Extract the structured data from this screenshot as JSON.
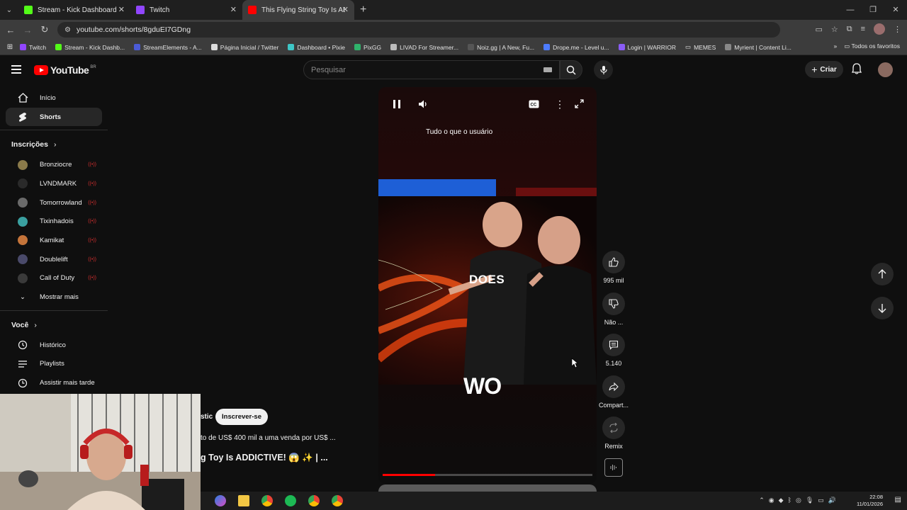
{
  "browser": {
    "tabs": [
      {
        "title": "Stream - Kick Dashboard",
        "color": "#53fc18"
      },
      {
        "title": "Twitch",
        "color": "#9146ff"
      },
      {
        "title": "This Flying String Toy Is ADDI",
        "color": "#ff0000"
      }
    ],
    "url": "youtube.com/shorts/8gduEI7GDng",
    "bookmarks": [
      {
        "label": "Twitch",
        "color": "#9146ff"
      },
      {
        "label": "Stream - Kick Dashb...",
        "color": "#53fc18"
      },
      {
        "label": "StreamElements - A...",
        "color": "#4b5bd6"
      },
      {
        "label": "Página Inicial / Twitter",
        "color": "#dddddd"
      },
      {
        "label": "Dashboard • Pixie",
        "color": "#3ec7c7"
      },
      {
        "label": "PixGG",
        "color": "#2fb36b"
      },
      {
        "label": "LIVAD For Streamer...",
        "color": "#bbbbbb"
      },
      {
        "label": "Noiz.gg | A New, Fu...",
        "color": "#222222"
      },
      {
        "label": "Drope.me - Level u...",
        "color": "#4d7cff"
      },
      {
        "label": "Login | WARRIOR",
        "color": "#8a5cf6"
      },
      {
        "label": "MEMES",
        "color": "#cccccc"
      },
      {
        "label": "Myrient | Content Li...",
        "color": "#888888"
      }
    ],
    "all_bookmarks_label": "Todos os favoritos"
  },
  "youtube": {
    "logo_text": "YouTube",
    "country_code": "BR",
    "search_placeholder": "Pesquisar",
    "create_label": "Criar"
  },
  "sidebar": {
    "home_label": "Início",
    "shorts_label": "Shorts",
    "subscriptions_title": "Inscrições",
    "subscriptions": [
      {
        "name": "Bronziocre",
        "color": "#8a7a4a"
      },
      {
        "name": "LVNDMARK",
        "color": "#2a2a2a"
      },
      {
        "name": "Tomorrowland",
        "color": "#6a6a6a"
      },
      {
        "name": "Tixinhadois",
        "color": "#3aa0a0"
      },
      {
        "name": "Kamikat",
        "color": "#c4743a"
      },
      {
        "name": "Doublelift",
        "color": "#4a4a6a"
      },
      {
        "name": "Call of Duty",
        "color": "#3a3a3a"
      }
    ],
    "show_more_label": "Mostrar mais",
    "you_title": "Você",
    "you_items": [
      {
        "label": "Histórico"
      },
      {
        "label": "Playlists"
      },
      {
        "label": "Assistir mais tarde"
      }
    ]
  },
  "short": {
    "overlay_title": "Tudo o que o usuário",
    "caption": "DOES",
    "watermark": "WO",
    "progress": 0.25,
    "channel_name_fragment": "stic",
    "subscribe_label": "Inscrever-se",
    "description": "to de US$ 400 mil a uma venda por US$ ...",
    "title": "g Toy Is ADDICTIVE! 😱 ✨ | ..."
  },
  "actions": {
    "like_count": "995 mil",
    "dislike_label": "Não ...",
    "comment_count": "5.140",
    "share_label": "Compart...",
    "remix_label": "Remix"
  },
  "taskbar": {
    "time": "22:08",
    "date": "11/01/2026"
  }
}
